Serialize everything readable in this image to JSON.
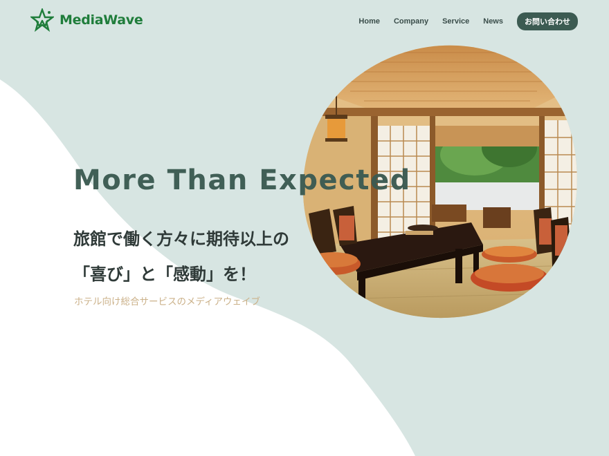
{
  "brand": {
    "name": "MediaWave",
    "logo_icon": "star-wave-logo-icon"
  },
  "nav": {
    "items": [
      {
        "label": "Home"
      },
      {
        "label": "Company"
      },
      {
        "label": "Service"
      },
      {
        "label": "News"
      }
    ],
    "cta_label": "お問い合わせ"
  },
  "hero": {
    "title": "More Than Expected",
    "line1": "旅館で働く方々に期待以上の",
    "line2": "「喜び」と「感動」を！",
    "subtitle": "ホテル向け総合サービスのメディアウェイブ",
    "photo_subject": "japanese-ryokan-tatami-room"
  },
  "colors": {
    "background": "#d7e5e2",
    "wave": "#ffffff",
    "brand_green": "#1f7d3b",
    "heading": "#3c5b52",
    "accent_gold": "#cbb189"
  }
}
